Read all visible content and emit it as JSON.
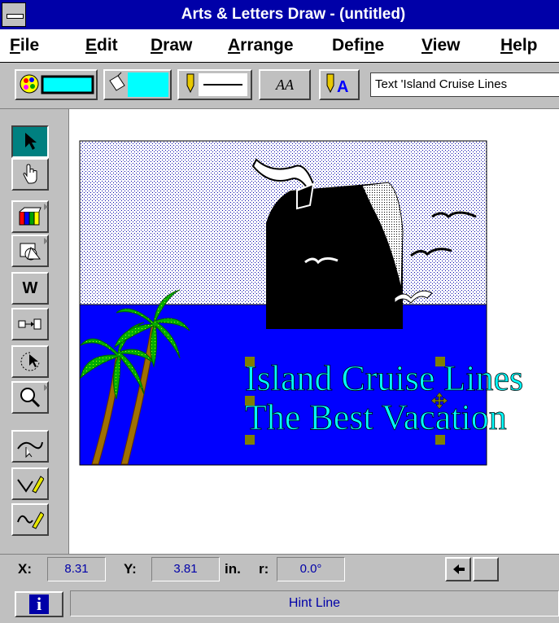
{
  "window": {
    "title": "Arts & Letters Draw - (untitled)"
  },
  "menu": {
    "items": [
      {
        "pre": "",
        "u": "F",
        "post": "ile"
      },
      {
        "pre": "",
        "u": "E",
        "post": "dit"
      },
      {
        "pre": "",
        "u": "D",
        "post": "raw"
      },
      {
        "pre": "",
        "u": "A",
        "post": "rrange"
      },
      {
        "pre": "Defi",
        "u": "n",
        "post": "e"
      },
      {
        "pre": "",
        "u": "V",
        "post": "iew"
      },
      {
        "pre": "",
        "u": "H",
        "post": "elp"
      }
    ]
  },
  "toolbar": {
    "fill_color": "#00ffff",
    "line_color": "#00ffff",
    "text_tool_label": "AA",
    "text_field": "Text 'Island Cruise Lines"
  },
  "tools": [
    {
      "name": "arrow-select-tool",
      "icon": "arrow-icon",
      "selected": true
    },
    {
      "name": "hand-tool",
      "icon": "hand-icon"
    },
    {
      "name": "symbol-library-tool",
      "icon": "library-icon",
      "flyout": true
    },
    {
      "name": "shapes-tool",
      "icon": "shapes-icon",
      "flyout": true
    },
    {
      "name": "word-tool",
      "icon": "w-icon",
      "label": "W"
    },
    {
      "name": "connector-tool",
      "icon": "connector-icon"
    },
    {
      "name": "rotate-tool",
      "icon": "rotate-icon"
    },
    {
      "name": "zoom-tool",
      "icon": "magnifier-icon",
      "flyout": true
    },
    {
      "name": "edit-points-tool",
      "icon": "curve-icon"
    },
    {
      "name": "pen-draw-tool",
      "icon": "pen-icon"
    },
    {
      "name": "freehand-tool",
      "icon": "freehand-icon"
    }
  ],
  "artwork": {
    "line1": "Island Cruise Lines",
    "line2": "The Best Vacation",
    "sky_color": "#ffffff",
    "sky_dot_color": "#0000a8",
    "sea_color": "#0000ff",
    "text_fill": "#00ffff"
  },
  "status": {
    "x_label": "X:",
    "x_value": "8.31",
    "y_label": "Y:",
    "y_value": "3.81",
    "unit": "in.",
    "r_label": "r:",
    "r_value": "0.0°",
    "hint": "Hint Line"
  }
}
